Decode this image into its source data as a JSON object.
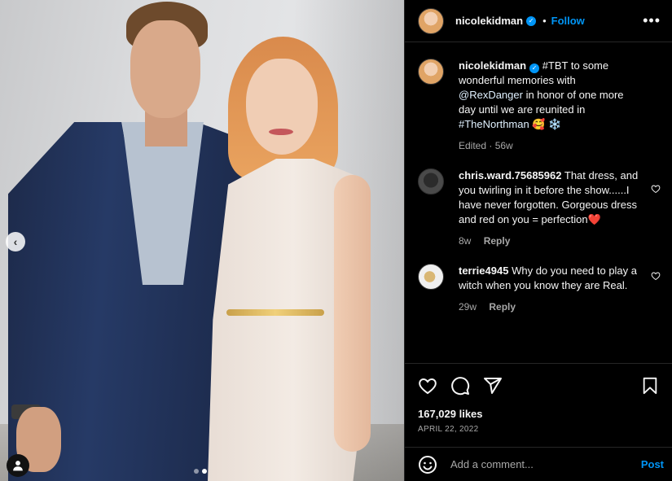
{
  "post": {
    "username": "nicolekidman",
    "follow_label": "Follow",
    "separator": "•",
    "more_label": "•••",
    "image_alt": "Alexander Skarsgård and Nicole Kidman posing together"
  },
  "caption": {
    "username": "nicolekidman",
    "text_start": "#TBT to some wonderful memories with ",
    "mention": "@RexDanger",
    "text_mid": " in honor of one more day until we are reunited in ",
    "hashtag": "#TheNorthman",
    "emoji": " 🥰 ❄️",
    "edited": "Edited · 56w"
  },
  "comments": [
    {
      "username": "chris.ward.75685962",
      "text": "That dress, and you twirling in it before the show......I have never forgotten. Gorgeous dress and red on you = perfection❤️",
      "time": "8w",
      "reply_label": "Reply"
    },
    {
      "username": "terrie4945",
      "text": "Why do you need to play a witch when you know they are Real.",
      "time": "29w",
      "reply_label": "Reply"
    }
  ],
  "stats": {
    "likes": "167,029 likes",
    "date": "APRIL 22, 2022"
  },
  "composer": {
    "placeholder": "Add a comment...",
    "post_label": "Post"
  },
  "icons": [
    "verified-icon",
    "more-icon",
    "heart-icon",
    "comment-icon",
    "share-icon",
    "save-icon",
    "emoji-icon",
    "carousel-prev-icon",
    "user-tag-icon"
  ],
  "colors": {
    "accent": "#0095f6",
    "background": "#000000",
    "muted": "#a8a8a8",
    "liked_heart": "#ed4956"
  }
}
